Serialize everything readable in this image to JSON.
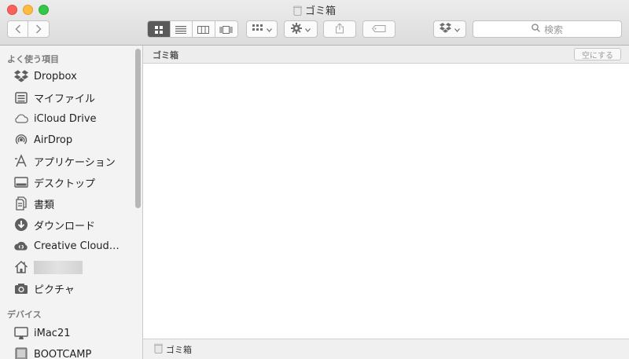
{
  "window": {
    "title": "ゴミ箱"
  },
  "toolbar": {
    "view_modes": [
      "icon",
      "list",
      "column",
      "coverflow"
    ],
    "active_view": "icon",
    "arrange_icon": "arrange-grid-icon",
    "action_icon": "gear-icon",
    "share_icon": "share-icon",
    "tag_icon": "tag-icon",
    "dropbox_icon": "dropbox-icon",
    "search_placeholder": "検索"
  },
  "sidebar": {
    "favorites_header": "よく使う項目",
    "favorites": [
      {
        "label": "Dropbox",
        "icon": "dropbox-icon"
      },
      {
        "label": "マイファイル",
        "icon": "all-my-files-icon"
      },
      {
        "label": "iCloud Drive",
        "icon": "cloud-icon"
      },
      {
        "label": "AirDrop",
        "icon": "airdrop-icon"
      },
      {
        "label": "アプリケーション",
        "icon": "applications-icon"
      },
      {
        "label": "デスクトップ",
        "icon": "desktop-icon"
      },
      {
        "label": "書類",
        "icon": "documents-icon"
      },
      {
        "label": "ダウンロード",
        "icon": "download-icon"
      },
      {
        "label": "Creative Cloud…",
        "icon": "creative-cloud-icon"
      },
      {
        "label": "",
        "icon": "home-icon",
        "redacted": true
      },
      {
        "label": "ピクチャ",
        "icon": "camera-icon"
      }
    ],
    "devices_header": "デバイス",
    "devices": [
      {
        "label": "iMac21",
        "icon": "imac-icon"
      },
      {
        "label": "BOOTCAMP",
        "icon": "disk-icon"
      }
    ]
  },
  "main": {
    "path_title": "ゴミ箱",
    "empty_button": "空にする",
    "status_label": "ゴミ箱"
  },
  "colors": {
    "close": "#fc605b",
    "minimize": "#fdbc40",
    "maximize": "#34c84a",
    "sidebar_bg": "#f3f3f3",
    "toolbar_bg": "#e3e3e3"
  }
}
